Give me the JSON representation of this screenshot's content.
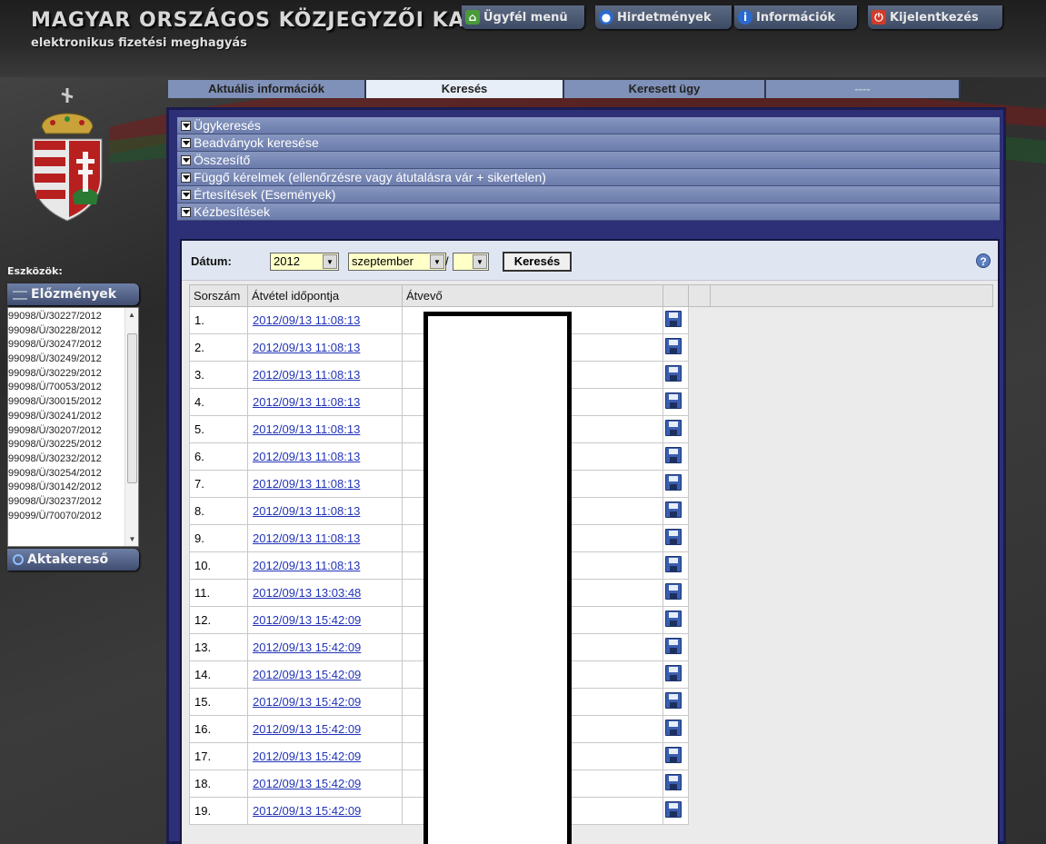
{
  "header": {
    "title": "MAGYAR ORSZÁGOS KÖZJEGYZŐI KAMARA",
    "subtitle": "elektronikus fizetési meghagyás",
    "nav": [
      {
        "label": "Ügyfél menü",
        "icon": "home-icon"
      },
      {
        "label": "Hirdetmények",
        "icon": "announcement-icon"
      },
      {
        "label": "Információk",
        "icon": "info-icon"
      },
      {
        "label": "Kijelentkezés",
        "icon": "logout-icon"
      }
    ]
  },
  "tabs": [
    {
      "label": "Aktuális információk",
      "active": false
    },
    {
      "label": "Keresés",
      "active": true
    },
    {
      "label": "Keresett ügy",
      "active": false
    },
    {
      "label": "----",
      "active": false
    }
  ],
  "sidebar": {
    "tools_label": "Eszközök:",
    "history_button": "Előzmények",
    "history": [
      "99098/Ü/30227/2012",
      "99098/Ü/30228/2012",
      "99098/Ü/30247/2012",
      "99098/Ü/30249/2012",
      "99098/Ü/30229/2012",
      "99098/Ü/70053/2012",
      "99098/Ü/30015/2012",
      "99098/Ü/30241/2012",
      "99098/Ü/30207/2012",
      "99098/Ü/30225/2012",
      "99098/Ü/30232/2012",
      "99098/Ü/30254/2012",
      "99098/Ü/30142/2012",
      "99098/Ü/30237/2012",
      "99099/Ü/70070/2012"
    ],
    "file_search_button": "Aktakereső"
  },
  "accordion": [
    "Ügykeresés",
    "Beadványok keresése",
    "Összesítő",
    "Függő kérelmek (ellenőrzésre vagy átutalásra vár + sikertelen)",
    "Értesítések (Események)",
    "Kézbesítések"
  ],
  "search": {
    "date_label": "Dátum:",
    "year": "2012",
    "month": "szeptember",
    "day": "",
    "separator": "/",
    "button": "Keresés"
  },
  "table": {
    "columns": [
      "Sorszám",
      "Átvétel időpontja",
      "Átvevő"
    ],
    "rows": [
      {
        "num": "1.",
        "date": "2012/09/13 11:08:13"
      },
      {
        "num": "2.",
        "date": "2012/09/13 11:08:13"
      },
      {
        "num": "3.",
        "date": "2012/09/13 11:08:13"
      },
      {
        "num": "4.",
        "date": "2012/09/13 11:08:13"
      },
      {
        "num": "5.",
        "date": "2012/09/13 11:08:13"
      },
      {
        "num": "6.",
        "date": "2012/09/13 11:08:13"
      },
      {
        "num": "7.",
        "date": "2012/09/13 11:08:13"
      },
      {
        "num": "8.",
        "date": "2012/09/13 11:08:13"
      },
      {
        "num": "9.",
        "date": "2012/09/13 11:08:13"
      },
      {
        "num": "10.",
        "date": "2012/09/13 11:08:13"
      },
      {
        "num": "11.",
        "date": "2012/09/13 13:03:48"
      },
      {
        "num": "12.",
        "date": "2012/09/13 15:42:09"
      },
      {
        "num": "13.",
        "date": "2012/09/13 15:42:09"
      },
      {
        "num": "14.",
        "date": "2012/09/13 15:42:09"
      },
      {
        "num": "15.",
        "date": "2012/09/13 15:42:09"
      },
      {
        "num": "16.",
        "date": "2012/09/13 15:42:09"
      },
      {
        "num": "17.",
        "date": "2012/09/13 15:42:09"
      },
      {
        "num": "18.",
        "date": "2012/09/13 15:42:09"
      },
      {
        "num": "19.",
        "date": "2012/09/13 15:42:09"
      }
    ]
  },
  "colors": {
    "panel_bg": "#2d2f77",
    "accordion": "#7b8bb6",
    "link": "#2233b8"
  }
}
